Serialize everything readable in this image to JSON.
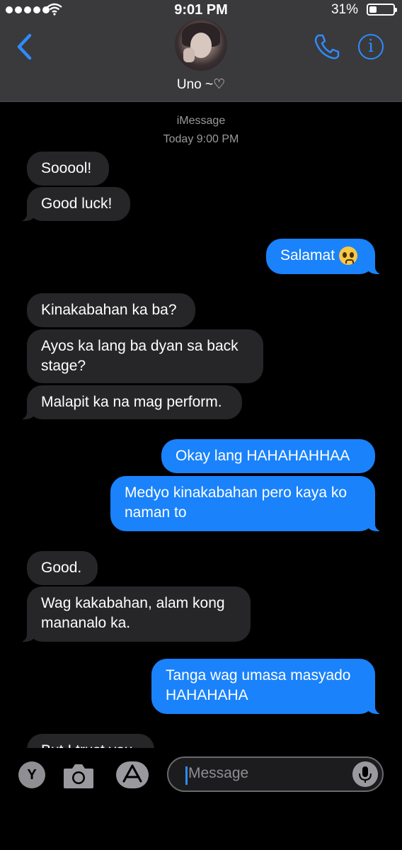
{
  "status_bar": {
    "time": "9:01 PM",
    "battery_percent": "31%",
    "battery_level": 0.31
  },
  "header": {
    "contact_name": "Uno ~♡"
  },
  "thread": {
    "service": "iMessage",
    "timestamp": "Today 9:00 PM",
    "messages": [
      {
        "dir": "in",
        "text": "Sooool!"
      },
      {
        "dir": "in",
        "text": "Good luck!"
      },
      {
        "dir": "out",
        "text": "Salamat",
        "emoji": "pleading-face"
      },
      {
        "dir": "in",
        "text": "Kinakabahan ka ba?"
      },
      {
        "dir": "in",
        "text": "Ayos ka lang ba dyan sa back stage?"
      },
      {
        "dir": "in",
        "text": "Malapit ka na mag perform."
      },
      {
        "dir": "out",
        "text": "Okay lang HAHAHAHHAA"
      },
      {
        "dir": "out",
        "text": "Medyo kinakabahan pero kaya ko naman to"
      },
      {
        "dir": "in",
        "text": "Good."
      },
      {
        "dir": "in",
        "text": "Wag kakabahan, alam kong mananalo ka."
      },
      {
        "dir": "out",
        "text": "Tanga wag umasa masyado HAHAHAHA"
      },
      {
        "dir": "in",
        "text": "But I trust you"
      }
    ]
  },
  "input_bar": {
    "app_label": "Y",
    "placeholder": "Message"
  },
  "colors": {
    "outgoing": "#1a82fb",
    "incoming": "#262629",
    "accent": "#2f8bff",
    "header": "#3a3a3c"
  }
}
